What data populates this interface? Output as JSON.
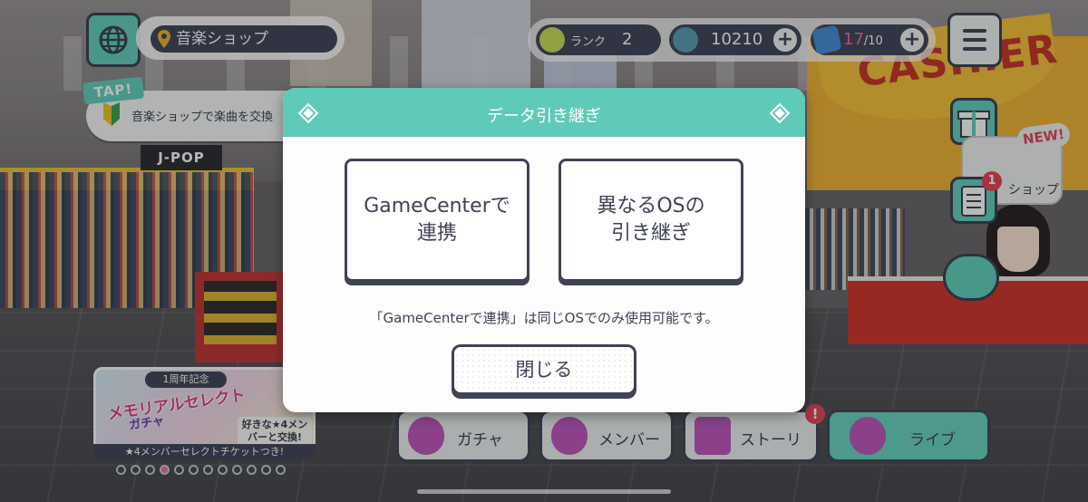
{
  "location": {
    "name": "音楽ショップ"
  },
  "tap_hint": {
    "badge": "TAP!",
    "text": "音楽ショップで楽曲を交換"
  },
  "status": {
    "rank_label": "ランク",
    "rank_value": "2",
    "gems": "10210",
    "stamina_current": "17",
    "stamina_max": "/10",
    "plus": "+"
  },
  "side": {
    "shop_label": "ショップ",
    "new_badge": "NEW!",
    "list_notification": "1"
  },
  "background": {
    "jpop_sign": "J-POP",
    "cashier_sign": "CASHIER"
  },
  "modal": {
    "title": "データ引き継ぎ",
    "option_gamecenter": "GameCenterで\n連携",
    "option_other_os": "異なるOSの\n引き継ぎ",
    "note": "「GameCenterで連携」は同じOSでのみ使用可能です。",
    "close_label": "閉じる"
  },
  "event_banner": {
    "anniversary": "1周年記念",
    "title": "メモリアルセレクト",
    "subtitle": "ガチャ",
    "side_text": "好きな★4メンバーと交換!",
    "footer": "★4メンバーセレクトチケットつき!",
    "page_count": 12,
    "active_page": 4
  },
  "nav": {
    "gacha": "ガチャ",
    "member": "メンバー",
    "story": "ストーリー",
    "live": "ライブ",
    "story_alert": "!"
  },
  "colors": {
    "accent": "#5fcab8",
    "dark": "#3e4454",
    "alert": "#e5485e",
    "stamina": "#f26ea0"
  }
}
